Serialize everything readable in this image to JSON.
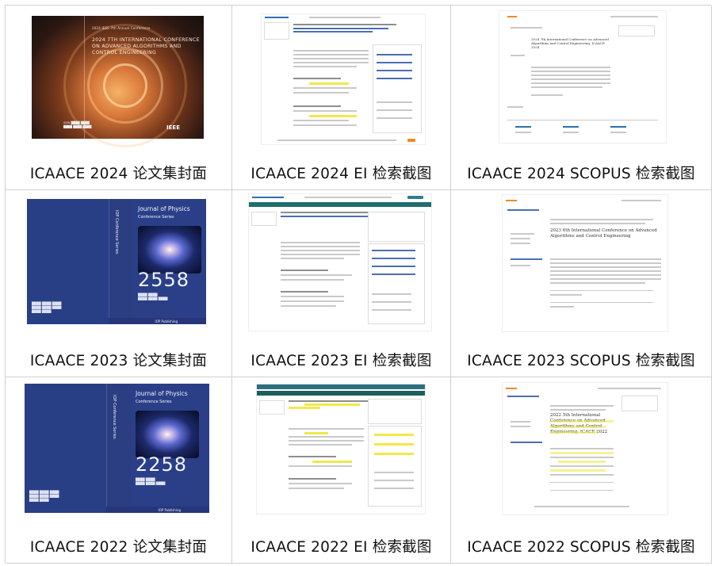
{
  "captions": [
    "ICAACE 2024 论文集封面",
    "ICAACE 2024 EI 检索截图",
    "ICAACE 2024 SCOPUS 检索截图",
    "ICAACE 2023 论文集封面",
    "ICAACE 2023 EI 检索截图",
    "ICAACE 2023 SCOPUS 检索截图",
    "ICAACE 2022 论文集封面",
    "ICAACE 2022 EI 检索截图",
    "ICAACE 2022 SCOPUS 检索截图"
  ],
  "cover_2024": {
    "header_small": "2024 IEEE 7th Annual Conference",
    "title": "2024 7TH INTERNATIONAL CONFERENCE ON ADVANCED ALGORITHMS AND CONTROL ENGINEERING",
    "logo": "IEEE"
  },
  "cover_2023": {
    "series_title": "Journal of Physics",
    "series_subtitle": "Conference Series",
    "spine_text": "IOP Conference Series",
    "volume": "2558",
    "publisher": "IOP Publishing"
  },
  "cover_2022": {
    "series_title": "Journal of Physics",
    "series_subtitle": "Conference Series",
    "spine_text": "IOP Conference Series",
    "volume": "2258",
    "publisher": "IOP Publishing"
  },
  "scopus_2024": {
    "title": "2024 7th International Conference on Advanced Algorithms and Control Engineering, ICAACE 2024"
  },
  "scopus_2023": {
    "title": "2023 6th International Conference on Advanced Algorithms and Control Engineering"
  },
  "scopus_2022": {
    "title": "2022 5th International Conference on Advanced Algorithms and Control Engineering, ICACE 2022"
  }
}
